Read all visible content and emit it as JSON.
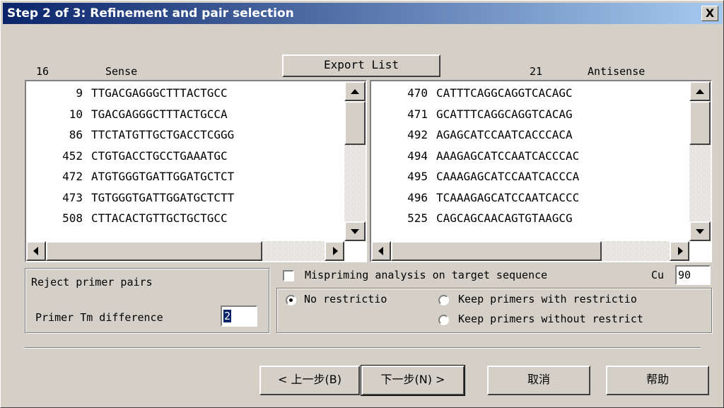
{
  "window": {
    "title": "Step 2 of 3: Refinement and pair selection",
    "close": "X"
  },
  "export_button": "Export List",
  "sense": {
    "count": "16",
    "label": "Sense",
    "rows": [
      {
        "pos": "9",
        "seq": "TTGACGAGGGCTTTACTGCC"
      },
      {
        "pos": "10",
        "seq": "TGACGAGGGCTTTACTGCCA"
      },
      {
        "pos": "86",
        "seq": "TTCTATGTTGCTGACCTCGGG"
      },
      {
        "pos": "452",
        "seq": "CTGTGACCTGCCTGAAATGC"
      },
      {
        "pos": "472",
        "seq": "ATGTGGGTGATTGGATGCTCT"
      },
      {
        "pos": "473",
        "seq": "TGTGGGTGATTGGATGCTCTT"
      },
      {
        "pos": "508",
        "seq": "CTTACACTGTTGCTGCTGCC"
      }
    ]
  },
  "antisense": {
    "count": "21",
    "label": "Antisense",
    "rows": [
      {
        "pos": "470",
        "seq": "CATTTCAGGCAGGTCACAGC"
      },
      {
        "pos": "471",
        "seq": "GCATTTCAGGCAGGTCACAG"
      },
      {
        "pos": "492",
        "seq": "AGAGCATCCAATCACCCACA"
      },
      {
        "pos": "494",
        "seq": "AAAGAGCATCCAATCACCCAC"
      },
      {
        "pos": "495",
        "seq": "CAAAGAGCATCCAATCACCCA"
      },
      {
        "pos": "496",
        "seq": "TCAAAGAGCATCCAATCACCC"
      },
      {
        "pos": "525",
        "seq": "CAGCAGCAACAGTGTAAGCG"
      }
    ]
  },
  "reject": {
    "title": "Reject primer pairs",
    "tm_label": "Primer Tm difference",
    "tm_value": "2"
  },
  "mispriming": {
    "label": "Mispriming analysis on target sequence",
    "cu_label": "Cu",
    "cu_value": "90",
    "checked": false
  },
  "restriction": {
    "options": [
      "No restrictio",
      "Keep primers with restrictio",
      "Keep primers without restrict"
    ],
    "selected": "No restrictio"
  },
  "buttons": {
    "back": "< 上一步(B)",
    "next": "下一步(N) >",
    "cancel": "取消",
    "help": "帮助"
  }
}
